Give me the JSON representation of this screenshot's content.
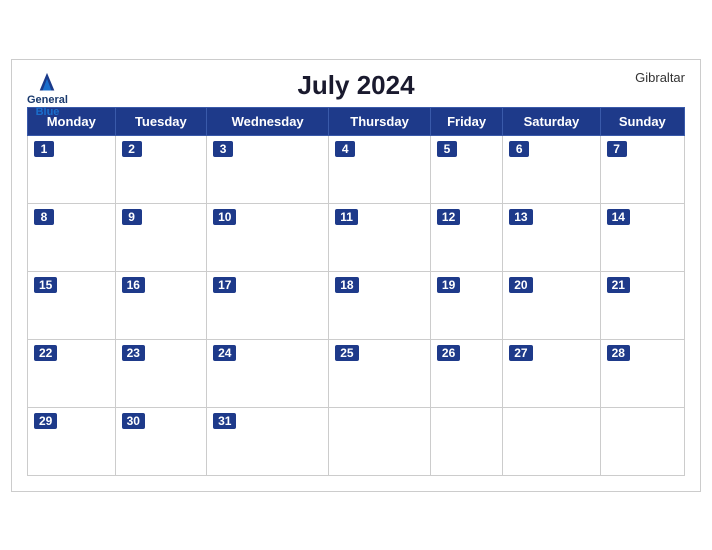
{
  "logo": {
    "line1": "General",
    "line2": "Blue"
  },
  "title": "July 2024",
  "location": "Gibraltar",
  "weekdays": [
    "Monday",
    "Tuesday",
    "Wednesday",
    "Thursday",
    "Friday",
    "Saturday",
    "Sunday"
  ],
  "weeks": [
    [
      {
        "day": 1,
        "empty": false
      },
      {
        "day": 2,
        "empty": false
      },
      {
        "day": 3,
        "empty": false
      },
      {
        "day": 4,
        "empty": false
      },
      {
        "day": 5,
        "empty": false
      },
      {
        "day": 6,
        "empty": false
      },
      {
        "day": 7,
        "empty": false
      }
    ],
    [
      {
        "day": 8,
        "empty": false
      },
      {
        "day": 9,
        "empty": false
      },
      {
        "day": 10,
        "empty": false
      },
      {
        "day": 11,
        "empty": false
      },
      {
        "day": 12,
        "empty": false
      },
      {
        "day": 13,
        "empty": false
      },
      {
        "day": 14,
        "empty": false
      }
    ],
    [
      {
        "day": 15,
        "empty": false
      },
      {
        "day": 16,
        "empty": false
      },
      {
        "day": 17,
        "empty": false
      },
      {
        "day": 18,
        "empty": false
      },
      {
        "day": 19,
        "empty": false
      },
      {
        "day": 20,
        "empty": false
      },
      {
        "day": 21,
        "empty": false
      }
    ],
    [
      {
        "day": 22,
        "empty": false
      },
      {
        "day": 23,
        "empty": false
      },
      {
        "day": 24,
        "empty": false
      },
      {
        "day": 25,
        "empty": false
      },
      {
        "day": 26,
        "empty": false
      },
      {
        "day": 27,
        "empty": false
      },
      {
        "day": 28,
        "empty": false
      }
    ],
    [
      {
        "day": 29,
        "empty": false
      },
      {
        "day": 30,
        "empty": false
      },
      {
        "day": 31,
        "empty": false
      },
      {
        "day": null,
        "empty": true
      },
      {
        "day": null,
        "empty": true
      },
      {
        "day": null,
        "empty": true
      },
      {
        "day": null,
        "empty": true
      }
    ]
  ]
}
